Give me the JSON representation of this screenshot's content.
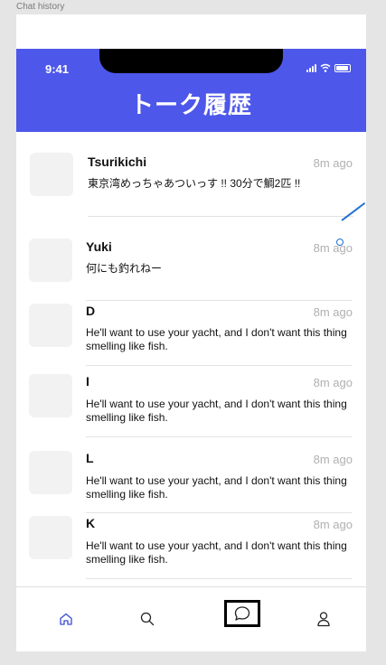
{
  "frame_label": "Chat history",
  "status_bar": {
    "time": "9:41"
  },
  "header": {
    "title": "トーク履歴"
  },
  "chats": [
    {
      "name": "Tsurikichi",
      "time": "8m ago",
      "message": "東京湾めっちゃあついっす !! 30分で鯛2匹 !!"
    },
    {
      "name": "Yuki",
      "time": "8m ago",
      "message": "何にも釣れねー"
    },
    {
      "name": "D",
      "time": "8m ago",
      "message": "He'll want to use your yacht, and I don't want this thing smelling like fish."
    },
    {
      "name": "I",
      "time": "8m ago",
      "message": "He'll want to use your yacht, and I don't want this thing smelling like fish."
    },
    {
      "name": "L",
      "time": "8m ago",
      "message": "He'll want to use your yacht, and I don't want this thing smelling like fish."
    },
    {
      "name": "K",
      "time": "8m ago",
      "message": "He'll want to use your yacht, and I don't want this thing smelling like fish."
    }
  ],
  "tabbar": {
    "tabs": [
      {
        "icon": "home-icon",
        "active": false
      },
      {
        "icon": "search-icon",
        "active": false
      },
      {
        "icon": "chat-bubble-icon",
        "active": true
      },
      {
        "icon": "user-icon",
        "active": false
      }
    ]
  },
  "colors": {
    "header": "#4d57ea",
    "home_icon": "#3b4bd6"
  }
}
